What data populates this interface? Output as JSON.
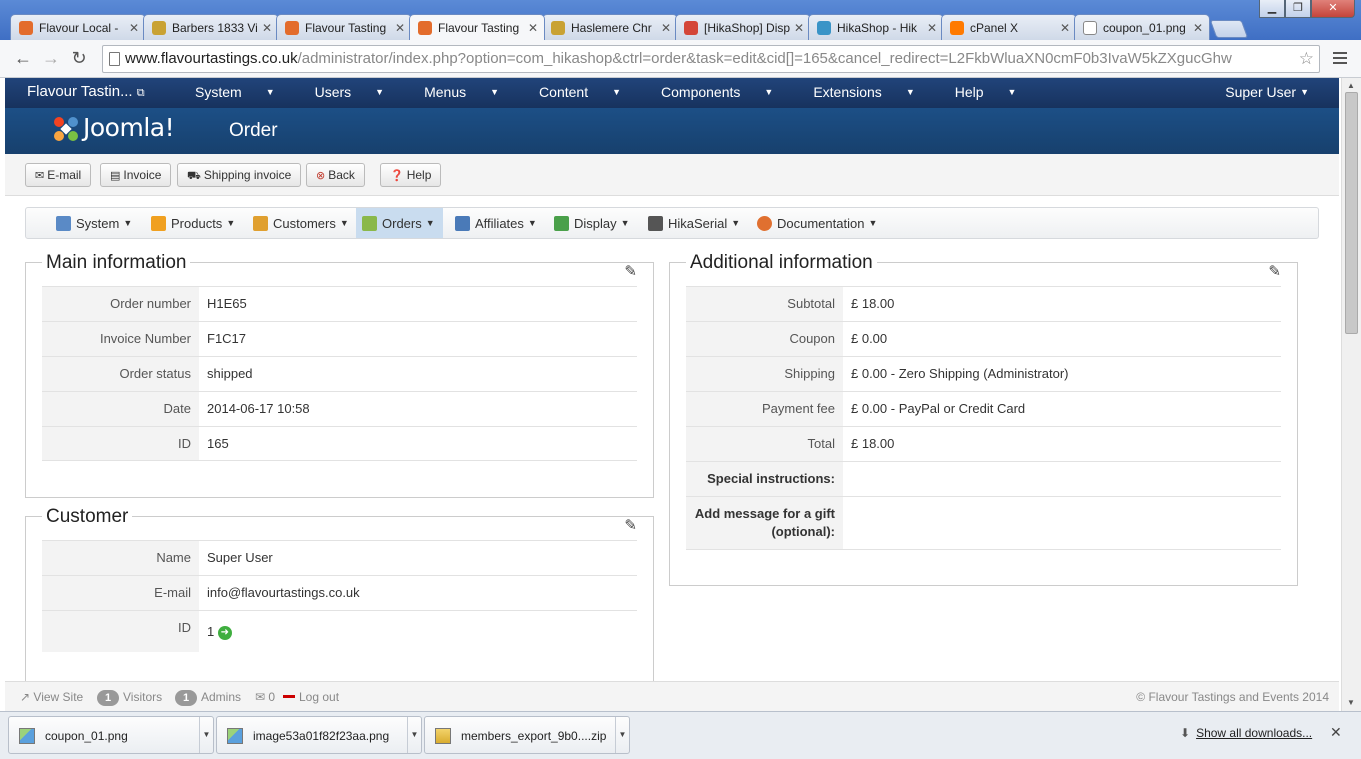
{
  "browser": {
    "tabs": [
      {
        "label": "Flavour Local -",
        "icon_color": "#e36c2c"
      },
      {
        "label": "Barbers 1833 Vi",
        "icon_color": "#c9a233"
      },
      {
        "label": "Flavour Tasting",
        "icon_color": "#e36c2c"
      },
      {
        "label": "Flavour Tasting",
        "icon_color": "#e36c2c",
        "active": true
      },
      {
        "label": "Haslemere Chr",
        "icon_color": "#c9a233"
      },
      {
        "label": "[HikaShop] Disp",
        "icon_color": "#d44638"
      },
      {
        "label": "HikaShop - Hik",
        "icon_color": "#3a94c7"
      },
      {
        "label": "cPanel X",
        "icon_color": "#ff7a00"
      },
      {
        "label": "coupon_01.png",
        "icon_color": "#ffffff"
      }
    ],
    "url_host": "www.flavourtastings.co.uk",
    "url_path": "/administrator/index.php?option=com_hikashop&ctrl=order&task=edit&cid[]=165&cancel_redirect=L2FkbWluaXN0cmF0b3IvaW5kZXgucGhw"
  },
  "joomla_nav": {
    "brand": "Flavour Tastin...",
    "menu": [
      "System",
      "Users",
      "Menus",
      "Content",
      "Components",
      "Extensions",
      "Help"
    ],
    "user": "Super User"
  },
  "header": {
    "logo_text": "Joomla!",
    "title": "Order"
  },
  "actions": [
    {
      "label": "E-mail",
      "icon": "envelope-icon"
    },
    {
      "label": "Invoice",
      "icon": "document-icon"
    },
    {
      "label": "Shipping invoice",
      "icon": "truck-icon"
    },
    {
      "label": "Back",
      "icon": "cancel-icon"
    },
    {
      "label": "Help",
      "icon": "question-icon"
    }
  ],
  "hika_menu": [
    {
      "label": "System",
      "icon": "tools-icon",
      "color": "#5a8ac6"
    },
    {
      "label": "Products",
      "icon": "box-icon",
      "color": "#f0a020"
    },
    {
      "label": "Customers",
      "icon": "users-icon",
      "color": "#e0a030"
    },
    {
      "label": "Orders",
      "icon": "orders-icon",
      "color": "#8ab84a",
      "active": true
    },
    {
      "label": "Affiliates",
      "icon": "affiliates-icon",
      "color": "#4a7ab8"
    },
    {
      "label": "Display",
      "icon": "display-icon",
      "color": "#4aa04a"
    },
    {
      "label": "HikaSerial",
      "icon": "serial-icon",
      "color": "#555555"
    },
    {
      "label": "Documentation",
      "icon": "lifebuoy-icon",
      "color": "#e07030"
    }
  ],
  "main_info": {
    "title": "Main information",
    "rows": [
      {
        "label": "Order number",
        "value": "H1E65"
      },
      {
        "label": "Invoice Number",
        "value": "F1C17"
      },
      {
        "label": "Order status",
        "value": "shipped"
      },
      {
        "label": "Date",
        "value": "2014-06-17 10:58"
      },
      {
        "label": "ID",
        "value": "165"
      }
    ]
  },
  "customer": {
    "title": "Customer",
    "rows": [
      {
        "label": "Name",
        "value": "Super User"
      },
      {
        "label": "E-mail",
        "value": "info@flavourtastings.co.uk"
      },
      {
        "label": "ID",
        "value": "1"
      }
    ]
  },
  "additional_info": {
    "title": "Additional information",
    "rows": [
      {
        "label": "Subtotal",
        "value": "£ 18.00"
      },
      {
        "label": "Coupon",
        "value": "£ 0.00"
      },
      {
        "label": "Shipping",
        "value": "£ 0.00 - Zero Shipping (Administrator)"
      },
      {
        "label": "Payment fee",
        "value": "£ 0.00 - PayPal or Credit Card"
      },
      {
        "label": "Total",
        "value": "£ 18.00"
      },
      {
        "label": "Special instructions:",
        "value": ""
      },
      {
        "label": "Add message for a gift (optional):",
        "value": ""
      }
    ]
  },
  "status_bar": {
    "view_site": "View Site",
    "visitors_count": "1",
    "visitors_label": "Visitors",
    "admins_count": "1",
    "admins_label": "Admins",
    "messages_count": "0",
    "logout": "Log out",
    "copyright": "© Flavour Tastings and Events 2014"
  },
  "downloads": {
    "items": [
      {
        "name": "coupon_01.png"
      },
      {
        "name": "image53a01f82f23aa.png"
      },
      {
        "name": "members_export_9b0....zip"
      }
    ],
    "show_all": "Show all downloads..."
  }
}
